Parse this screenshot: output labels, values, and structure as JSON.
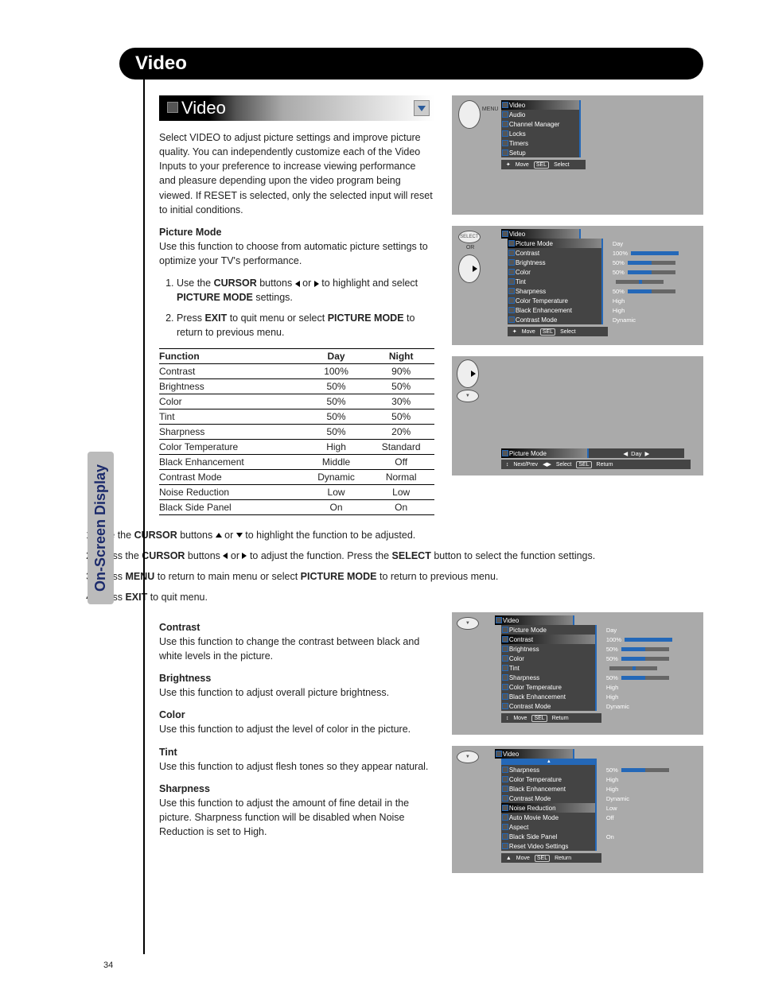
{
  "page": {
    "header": "Video",
    "tab": "On-Screen Display",
    "number": "34"
  },
  "section": {
    "bar_title": "Video",
    "intro": "Select VIDEO to adjust picture settings and improve picture quality. You can independently customize each of the Video Inputs to your preference to increase viewing performance and pleasure depending upon the video program being viewed. If RESET is selected, only the selected input will reset to initial conditions.",
    "picture_mode": {
      "heading": "Picture Mode",
      "desc": "Use this function to choose from automatic picture settings to optimize your TV's performance.",
      "step1_a": "Use the ",
      "step1_b": "CURSOR",
      "step1_c": " buttons ",
      "step1_d": " or ",
      "step1_e": " to highlight and select ",
      "step1_f": "PICTURE MODE",
      "step1_g": " settings.",
      "step2_a": "Press ",
      "step2_b": "EXIT",
      "step2_c": " to quit menu or select ",
      "step2_d": "PICTURE MODE",
      "step2_e": " to return to previous menu."
    },
    "fn_table": {
      "headers": [
        "Function",
        "Day",
        "Night"
      ],
      "rows": [
        [
          "Contrast",
          "100%",
          "90%"
        ],
        [
          "Brightness",
          "50%",
          "50%"
        ],
        [
          "Color",
          "50%",
          "30%"
        ],
        [
          "Tint",
          "50%",
          "50%"
        ],
        [
          "Sharpness",
          "50%",
          "20%"
        ],
        [
          "Color Temperature",
          "High",
          "Standard"
        ],
        [
          "Black Enhancement",
          "Middle",
          "Off"
        ],
        [
          "Contrast Mode",
          "Dynamic",
          "Normal"
        ],
        [
          "Noise Reduction",
          "Low",
          "Low"
        ],
        [
          "Black Side Panel",
          "On",
          "On"
        ]
      ]
    },
    "steps_full": {
      "s1_a": "Use the ",
      "s1_b": "CURSOR",
      "s1_c": " buttons ",
      "s1_d": " or ",
      "s1_e": " to highlight the function to be adjusted.",
      "s2_a": "Press the ",
      "s2_b": "CURSOR",
      "s2_c": " buttons ",
      "s2_d": " or ",
      "s2_e": " to adjust the function. Press the ",
      "s2_f": "SELECT",
      "s2_g": " button to select the function settings.",
      "s3_a": "Press ",
      "s3_b": "MENU",
      "s3_c": " to return to main menu or select ",
      "s3_d": "PICTURE MODE",
      "s3_e": " to return to previous menu.",
      "s4_a": "Press ",
      "s4_b": "EXIT",
      "s4_c": " to quit menu."
    },
    "defs": {
      "contrast_h": "Contrast",
      "contrast_d": "Use this function to change the contrast between black and white levels in the picture.",
      "brightness_h": "Brightness",
      "brightness_d": "Use this function to adjust overall picture brightness.",
      "color_h": "Color",
      "color_d": "Use this function to adjust the level of color in the picture.",
      "tint_h": "Tint",
      "tint_d": "Use this function to adjust flesh tones so they appear natural.",
      "sharpness_h": "Sharpness",
      "sharpness_d": "Use this function to adjust the amount of fine detail in the picture. Sharpness function will be disabled when Noise Reduction is set to High."
    }
  },
  "osd1": {
    "menu_label": "MENU",
    "items": [
      "Video",
      "Audio",
      "Channel Manager",
      "Locks",
      "Timers",
      "Setup"
    ],
    "footer_move": "Move",
    "footer_sel": "SEL",
    "footer_select": "Select"
  },
  "osd2": {
    "select_label": "SELECT",
    "or_label": "OR",
    "title": "Video",
    "items": [
      "Picture Mode",
      "Contrast",
      "Brightness",
      "Color",
      "Tint",
      "Sharpness",
      "Color Temperature",
      "Black Enhancement",
      "Contrast Mode"
    ],
    "values": [
      "Day",
      "100%",
      "50%",
      "50%",
      "",
      "50%",
      "High",
      "High",
      "Dynamic"
    ],
    "footer_move": "Move",
    "footer_sel": "SEL",
    "footer_select": "Select"
  },
  "osd3": {
    "title": "Picture Mode",
    "value": "Day",
    "footer_np": "Next/Prev",
    "footer_sel_arrows": "Select",
    "footer_sel": "SEL",
    "footer_return": "Return"
  },
  "osd4": {
    "title": "Video",
    "items": [
      "Picture Mode",
      "Contrast",
      "Brightness",
      "Color",
      "Tint",
      "Sharpness",
      "Color Temperature",
      "Black Enhancement",
      "Contrast Mode"
    ],
    "values": [
      "Day",
      "100%",
      "50%",
      "50%",
      "",
      "50%",
      "High",
      "High",
      "Dynamic"
    ],
    "footer_move": "Move",
    "footer_sel": "SEL",
    "footer_return": "Return"
  },
  "osd5": {
    "title": "Video",
    "items": [
      "Sharpness",
      "Color Temperature",
      "Black Enhancement",
      "Contrast Mode",
      "Noise Reduction",
      "Auto Movie Mode",
      "Aspect",
      "Black Side Panel",
      "Reset Video Settings"
    ],
    "values": [
      "50%",
      "High",
      "High",
      "Dynamic",
      "Low",
      "Off",
      "",
      "On",
      ""
    ],
    "footer_move": "Move",
    "footer_sel": "SEL",
    "footer_return": "Return"
  }
}
